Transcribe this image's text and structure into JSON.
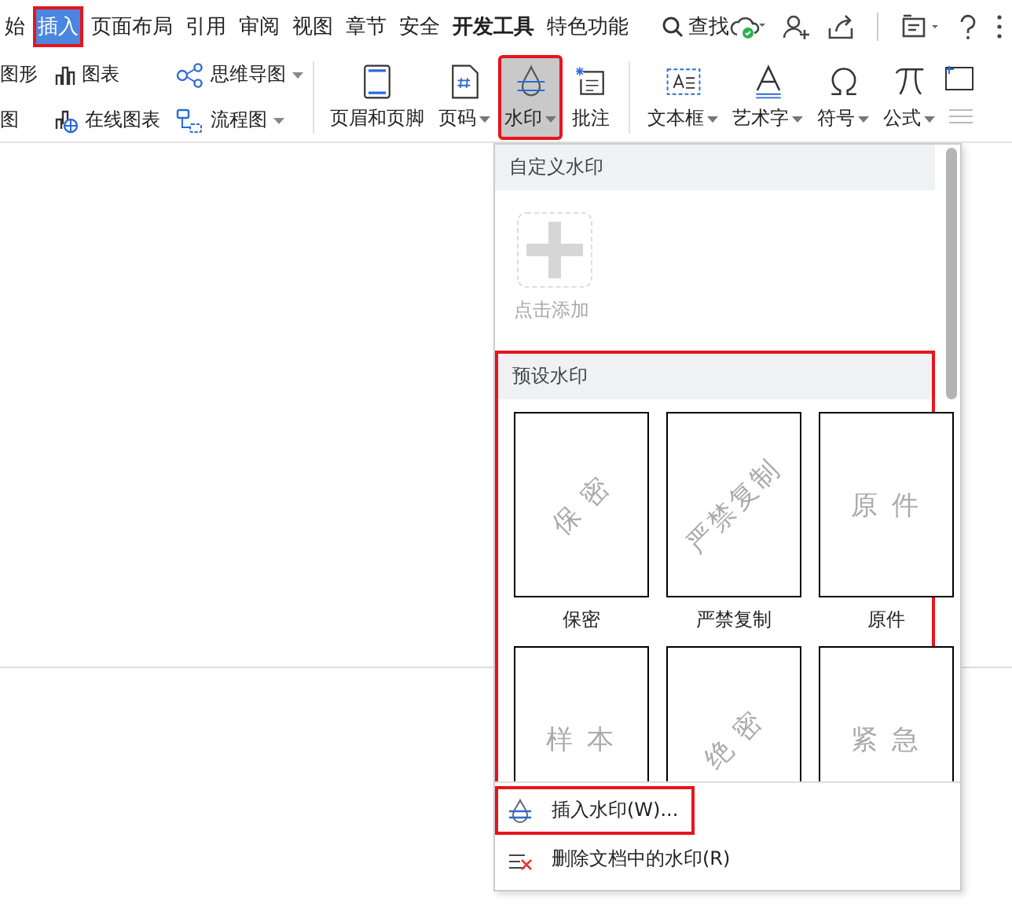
{
  "tabs": [
    {
      "label": "始",
      "selected": false,
      "bold": false,
      "annotated": false
    },
    {
      "label": "插入",
      "selected": true,
      "bold": false,
      "annotated": true
    },
    {
      "label": "页面布局",
      "selected": false,
      "bold": false,
      "annotated": false
    },
    {
      "label": "引用",
      "selected": false,
      "bold": false,
      "annotated": false
    },
    {
      "label": "审阅",
      "selected": false,
      "bold": false,
      "annotated": false
    },
    {
      "label": "视图",
      "selected": false,
      "bold": false,
      "annotated": false
    },
    {
      "label": "章节",
      "selected": false,
      "bold": false,
      "annotated": false
    },
    {
      "label": "安全",
      "selected": false,
      "bold": false,
      "annotated": false
    },
    {
      "label": "开发工具",
      "selected": false,
      "bold": true,
      "annotated": false
    },
    {
      "label": "特色功能",
      "selected": false,
      "bold": false,
      "annotated": false
    }
  ],
  "search": {
    "label": "查找"
  },
  "ribbon": {
    "small_columns": [
      [
        {
          "label": "图形",
          "kind": "cut",
          "dropdown": false
        },
        {
          "label": "图",
          "kind": "cut",
          "dropdown": false
        }
      ],
      [
        {
          "label": "图表",
          "kind": "chart",
          "dropdown": false
        },
        {
          "label": "在线图表",
          "kind": "online-chart",
          "dropdown": false
        }
      ],
      [
        {
          "label": "思维导图",
          "kind": "mindmap",
          "dropdown": true
        },
        {
          "label": "流程图",
          "kind": "flow",
          "dropdown": true
        }
      ]
    ],
    "big_buttons": [
      {
        "label": "页眉和页脚",
        "kind": "header-footer",
        "dropdown": false,
        "pressed": false,
        "annotated": false
      },
      {
        "label": "页码",
        "kind": "page-number",
        "dropdown": true,
        "pressed": false,
        "annotated": false
      },
      {
        "label": "水印",
        "kind": "watermark",
        "dropdown": true,
        "pressed": true,
        "annotated": true
      },
      {
        "label": "批注",
        "kind": "comment",
        "dropdown": false,
        "pressed": false,
        "annotated": false
      },
      {
        "label": "文本框",
        "kind": "textbox",
        "dropdown": true,
        "pressed": false,
        "annotated": false
      },
      {
        "label": "艺术字",
        "kind": "wordart",
        "dropdown": true,
        "pressed": false,
        "annotated": false
      },
      {
        "label": "符号",
        "kind": "symbol",
        "dropdown": true,
        "pressed": false,
        "annotated": false
      },
      {
        "label": "公式",
        "kind": "formula",
        "dropdown": true,
        "pressed": false,
        "annotated": false
      }
    ]
  },
  "watermark_menu": {
    "custom_header": "自定义水印",
    "add_label": "点击添加",
    "preset_header": "预设水印",
    "presets_annotated": true,
    "presets": [
      {
        "text": "保 密",
        "label": "保密",
        "rotated": true
      },
      {
        "text": "严禁复制",
        "label": "严禁复制",
        "rotated": true
      },
      {
        "text": "原 件",
        "label": "原件",
        "rotated": false
      },
      {
        "text": "样 本",
        "rotated": false
      },
      {
        "text": "绝 密",
        "rotated": true
      },
      {
        "text": "紧 急",
        "rotated": false
      }
    ],
    "actions": [
      {
        "label": "插入水印(W)...",
        "kind": "insert",
        "annotated": true
      },
      {
        "label": "删除文档中的水印(R)",
        "kind": "delete",
        "annotated": false
      }
    ]
  }
}
